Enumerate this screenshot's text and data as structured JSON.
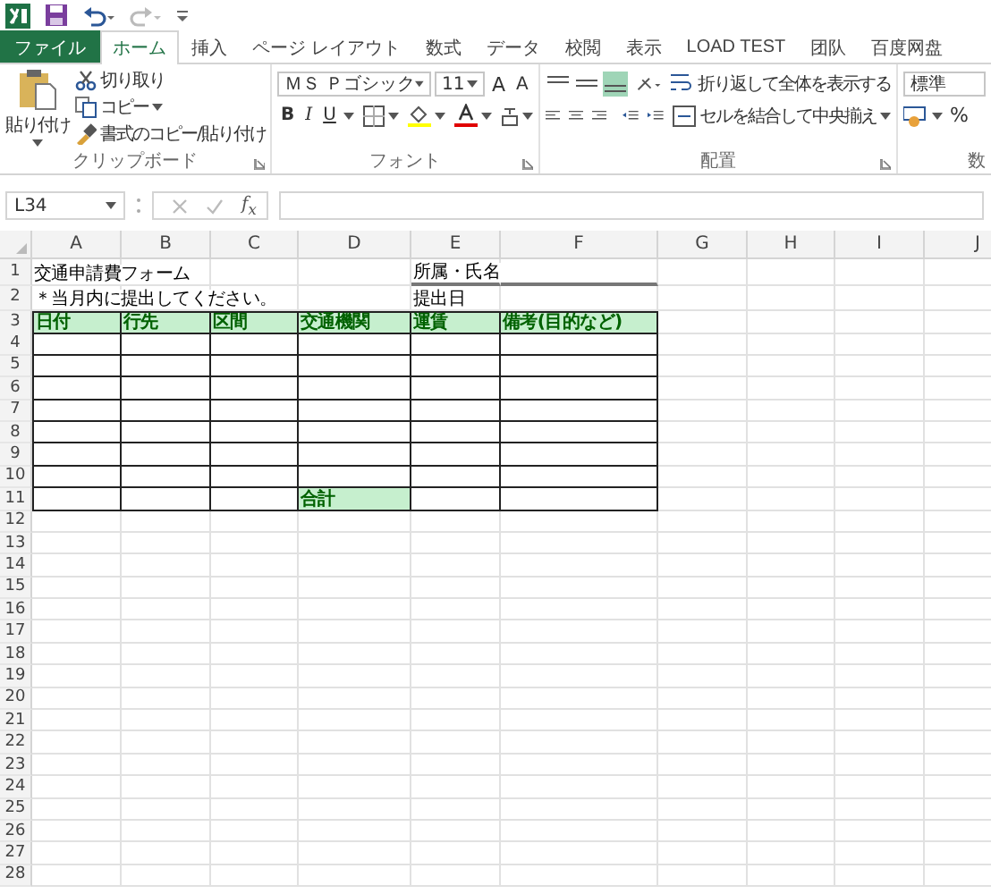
{
  "tabs": [
    {
      "label": "ファイル",
      "kind": "file",
      "selected": false
    },
    {
      "label": "ホーム",
      "kind": "tab",
      "selected": true
    },
    {
      "label": "挿入",
      "kind": "tab",
      "selected": false
    },
    {
      "label": "ページ レイアウト",
      "kind": "tab",
      "selected": false
    },
    {
      "label": "数式",
      "kind": "tab",
      "selected": false
    },
    {
      "label": "データ",
      "kind": "tab",
      "selected": false
    },
    {
      "label": "校閲",
      "kind": "tab",
      "selected": false
    },
    {
      "label": "表示",
      "kind": "tab",
      "selected": false
    },
    {
      "label": "LOAD TEST",
      "kind": "tab",
      "selected": false
    },
    {
      "label": "团队",
      "kind": "tab",
      "selected": false
    },
    {
      "label": "百度网盘",
      "kind": "tab",
      "selected": false
    }
  ],
  "ribbon": {
    "clipboard": {
      "paste": "貼り付け",
      "cut": "切り取り",
      "copy": "コピー",
      "format_painter": "書式のコピー/貼り付け",
      "group_label": "クリップボード"
    },
    "font": {
      "name": "ＭＳ Ｐゴシック",
      "size": "11",
      "grow": "A",
      "shrink": "A",
      "bold": "B",
      "italic": "I",
      "underline": "U",
      "group_label": "フォント"
    },
    "alignment": {
      "vertical": [
        {
          "selected": false
        },
        {
          "selected": false
        },
        {
          "selected": true
        }
      ],
      "wrap": "折り返して全体を表示する",
      "merge": "セルを結合して中央揃え",
      "group_label": "配置"
    },
    "number": {
      "format": "標準",
      "percent": "%",
      "group_label": "数"
    }
  },
  "formula_bar": {
    "name_box": "L34",
    "function_label": "f$_{x}$"
  },
  "columns": [
    "A",
    "B",
    "C",
    "D",
    "E",
    "F",
    "G",
    "H",
    "I",
    "J"
  ],
  "rows": [
    {
      "number": "1",
      "cells": [
        {
          "kind": "text",
          "text": "交通申請費フォーム"
        },
        {
          "kind": "empty"
        },
        {
          "kind": "empty"
        },
        {
          "kind": "empty"
        },
        {
          "kind": "underlined",
          "text": "所属・氏名"
        },
        {
          "kind": "underlined"
        }
      ]
    },
    {
      "number": "2",
      "cells": [
        {
          "kind": "text",
          "text": "＊当月内に提出してください。"
        },
        {
          "kind": "empty"
        },
        {
          "kind": "empty"
        },
        {
          "kind": "empty"
        },
        {
          "kind": "text",
          "text": "提出日"
        }
      ]
    },
    {
      "number": "3",
      "cells": [
        {
          "kind": "header",
          "text": "日付"
        },
        {
          "kind": "header",
          "text": "行先"
        },
        {
          "kind": "header",
          "text": "区間"
        },
        {
          "kind": "header",
          "text": "交通機関"
        },
        {
          "kind": "header",
          "text": "運賃"
        },
        {
          "kind": "header",
          "text": "備考(目的など)"
        }
      ]
    },
    {
      "number": "4",
      "cells": [
        {
          "kind": "box"
        },
        {
          "kind": "box"
        },
        {
          "kind": "box"
        },
        {
          "kind": "box"
        },
        {
          "kind": "box"
        },
        {
          "kind": "box"
        }
      ]
    },
    {
      "number": "5",
      "cells": [
        {
          "kind": "box"
        },
        {
          "kind": "box"
        },
        {
          "kind": "box"
        },
        {
          "kind": "box"
        },
        {
          "kind": "box"
        },
        {
          "kind": "box"
        }
      ]
    },
    {
      "number": "6",
      "cells": [
        {
          "kind": "box"
        },
        {
          "kind": "box"
        },
        {
          "kind": "box"
        },
        {
          "kind": "box"
        },
        {
          "kind": "box"
        },
        {
          "kind": "box"
        }
      ]
    },
    {
      "number": "7",
      "cells": [
        {
          "kind": "box"
        },
        {
          "kind": "box"
        },
        {
          "kind": "box"
        },
        {
          "kind": "box"
        },
        {
          "kind": "box"
        },
        {
          "kind": "box"
        }
      ]
    },
    {
      "number": "8",
      "cells": [
        {
          "kind": "box"
        },
        {
          "kind": "box"
        },
        {
          "kind": "box"
        },
        {
          "kind": "box"
        },
        {
          "kind": "box"
        },
        {
          "kind": "box"
        }
      ]
    },
    {
      "number": "9",
      "cells": [
        {
          "kind": "box"
        },
        {
          "kind": "box"
        },
        {
          "kind": "box"
        },
        {
          "kind": "box"
        },
        {
          "kind": "box"
        },
        {
          "kind": "box"
        }
      ]
    },
    {
      "number": "10",
      "cells": [
        {
          "kind": "box"
        },
        {
          "kind": "box"
        },
        {
          "kind": "box"
        },
        {
          "kind": "box"
        },
        {
          "kind": "box"
        },
        {
          "kind": "box"
        }
      ]
    },
    {
      "number": "11",
      "cells": [
        {
          "kind": "box"
        },
        {
          "kind": "box"
        },
        {
          "kind": "box"
        },
        {
          "kind": "total",
          "text": "合計"
        },
        {
          "kind": "box"
        },
        {
          "kind": "box"
        }
      ]
    },
    {
      "number": "12"
    },
    {
      "number": "13"
    },
    {
      "number": "14"
    },
    {
      "number": "15"
    },
    {
      "number": "16"
    },
    {
      "number": "17"
    },
    {
      "number": "18"
    },
    {
      "number": "19"
    },
    {
      "number": "20"
    },
    {
      "number": "21"
    },
    {
      "number": "22"
    },
    {
      "number": "23"
    },
    {
      "number": "24"
    },
    {
      "number": "25"
    },
    {
      "number": "26"
    },
    {
      "number": "27"
    },
    {
      "number": "28"
    }
  ]
}
